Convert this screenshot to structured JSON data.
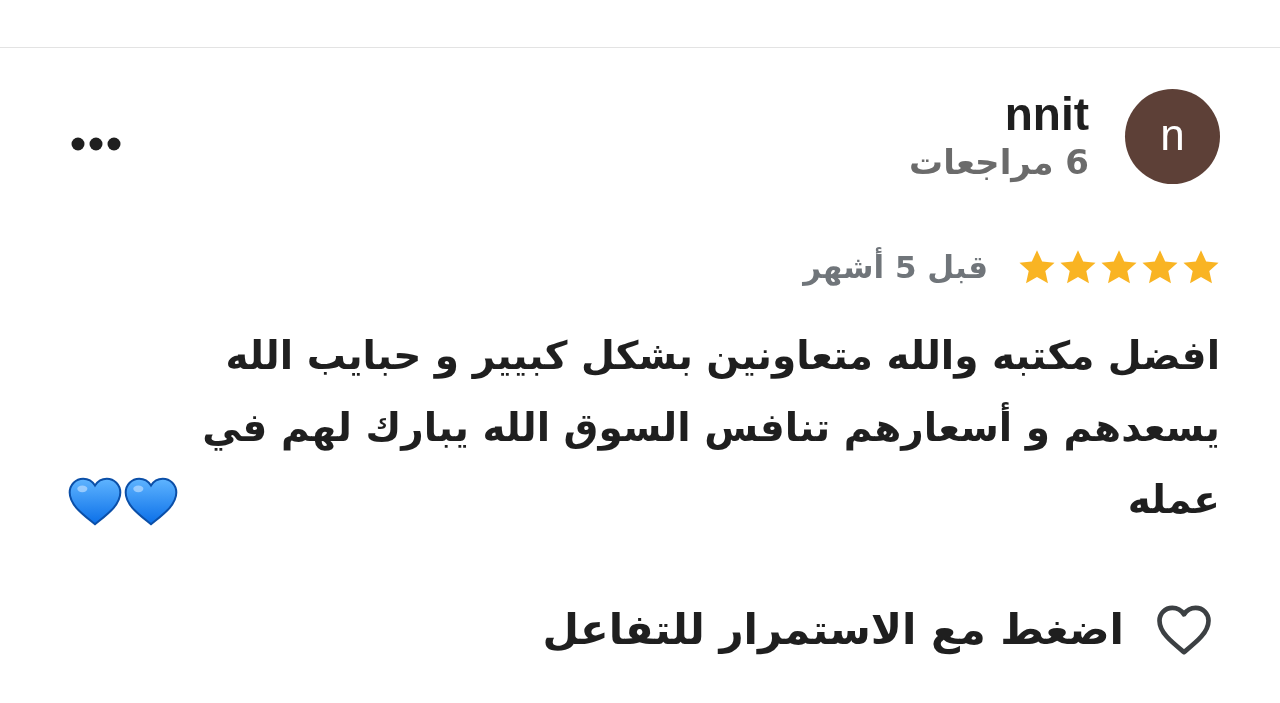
{
  "reviewer": {
    "avatar_letter": "n",
    "name": "nnit",
    "review_count": "6 مراجعات"
  },
  "rating": {
    "stars": 5,
    "time": "قبل 5 أشهر"
  },
  "review": {
    "text": "افضل مكتبه والله متعاونين بشكل كبيير و حبايب الله يسعدهم و أسعارهم تنافس السوق الله يبارك لهم في عمله",
    "emoji": [
      {
        "kind": "blue-heart"
      },
      {
        "kind": "blue-heart"
      }
    ]
  },
  "reaction": {
    "label": "اضغط مع الاستمرار للتفاعل",
    "liked": false
  }
}
